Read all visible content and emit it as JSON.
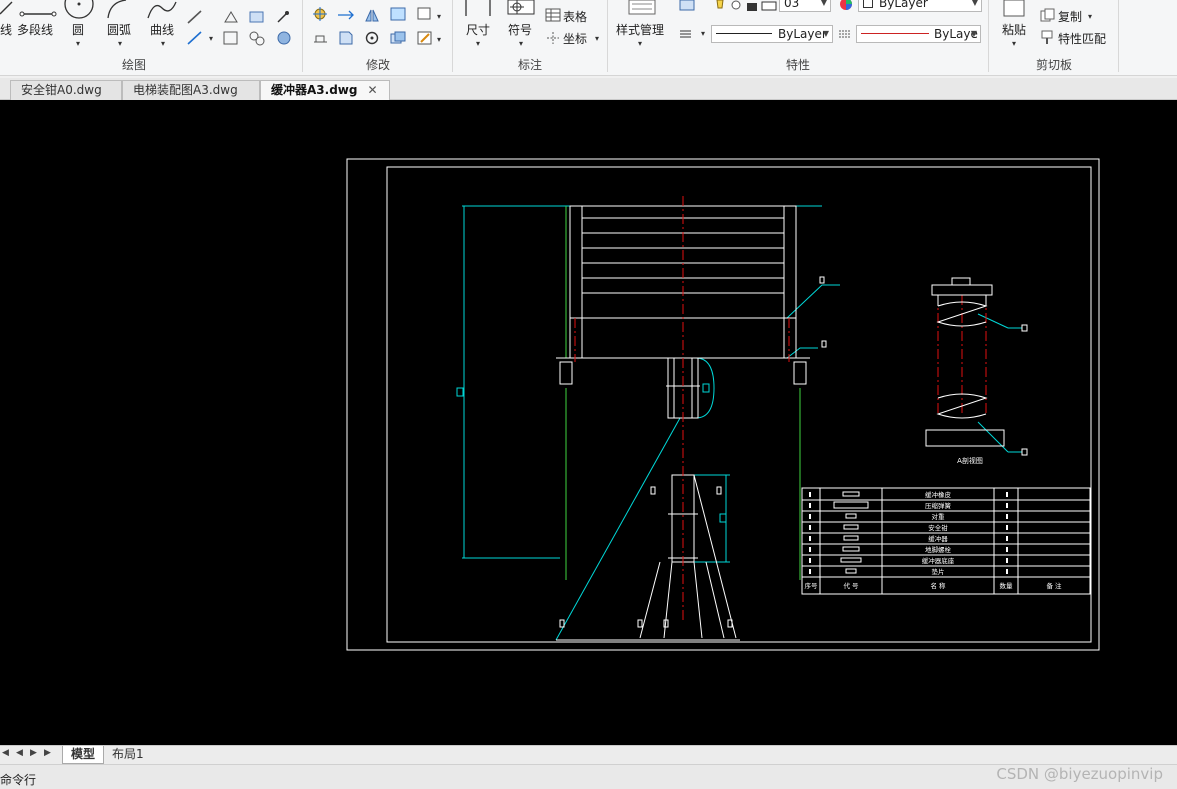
{
  "ribbon": {
    "draw_panel": {
      "title": "绘图",
      "line_label": "线",
      "polyline_label": "多段线",
      "circle_label": "圆",
      "arc_label": "圆弧",
      "spline_label": "曲线"
    },
    "modify_panel": {
      "title": "修改"
    },
    "annotate_panel": {
      "title": "标注",
      "dimension_label": "尺寸",
      "symbol_label": "符号",
      "table_label": "表格",
      "coordinate_label": "坐标"
    },
    "properties_panel": {
      "title": "特性",
      "style_manager_label": "样式管理",
      "layer_value": "03",
      "color_value": "ByLayer",
      "linetype_value": "ByLayer",
      "lineweight_value": "ByLaye"
    },
    "clipboard_panel": {
      "title": "剪切板",
      "paste_label": "粘贴",
      "copy_label": "复制",
      "match_props_label": "特性匹配"
    }
  },
  "doc_tabs": [
    {
      "label": "安全钳A0.dwg",
      "active": false
    },
    {
      "label": "电梯装配图A3.dwg",
      "active": false
    },
    {
      "label": "缓冲器A3.dwg",
      "active": true
    }
  ],
  "drawing": {
    "view_caption": "A剖视图",
    "bom_rows": [
      {
        "name": "缓冲橡皮"
      },
      {
        "name": "压缩弹簧"
      },
      {
        "name": "对重"
      },
      {
        "name": "安全钳"
      },
      {
        "name": "缓冲器"
      },
      {
        "name": "地脚螺栓"
      },
      {
        "name": "缓冲器底座"
      },
      {
        "name": "垫片"
      }
    ],
    "bom_header": {
      "seq": "序号",
      "code": "代 号",
      "name": "名 称",
      "qty": "数量",
      "note": "备 注"
    }
  },
  "layout_tabs": [
    {
      "label": "模型",
      "active": true
    },
    {
      "label": "布局1",
      "active": false
    }
  ],
  "command": {
    "label": "命令行"
  },
  "watermark": "CSDN @biyezuopinvip",
  "colors": {
    "canvas_bg": "#000000",
    "cyan": "#00d8d8",
    "green": "#3fd43f",
    "red": "#e01010",
    "white": "#ffffff"
  }
}
